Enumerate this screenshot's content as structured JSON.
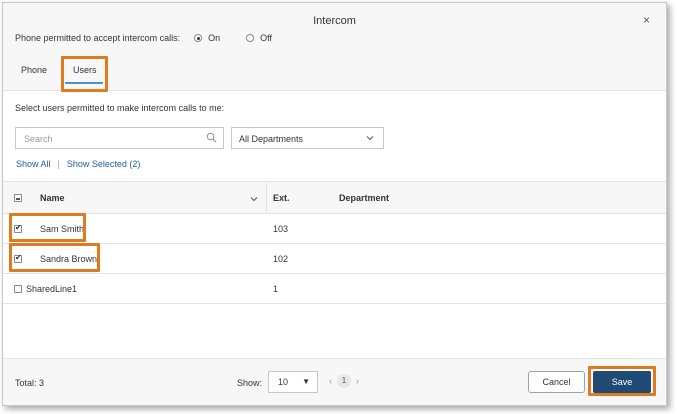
{
  "dialog": {
    "title": "Intercom",
    "close_glyph": "×"
  },
  "permission": {
    "label": "Phone permitted to accept intercom calls:",
    "options": [
      {
        "label": "On",
        "selected": true
      },
      {
        "label": "Off",
        "selected": false
      }
    ]
  },
  "tabs": [
    {
      "label": "Phone",
      "active": false
    },
    {
      "label": "Users",
      "active": true
    }
  ],
  "instructions": "Select users permitted to make intercom calls to me:",
  "search": {
    "placeholder": "Search",
    "icon": "search-icon"
  },
  "department_select": {
    "value": "All Departments",
    "icon": "chevron-down-icon"
  },
  "filters": {
    "show_all": "Show All",
    "separator": "|",
    "show_selected": "Show Selected (2)"
  },
  "table": {
    "columns": [
      "Name",
      "Ext.",
      "Department"
    ],
    "sort_glyph": "⌄",
    "rows": [
      {
        "name": "Sam Smith",
        "ext": "103",
        "department": "",
        "checked": true
      },
      {
        "name": "Sandra Brown",
        "ext": "102",
        "department": "",
        "checked": true
      },
      {
        "name": "SharedLine1",
        "ext": "1",
        "department": "",
        "checked": false
      }
    ]
  },
  "footer": {
    "total": "Total: 3",
    "show_label": "Show:",
    "page_size": "10",
    "page_size_arrow": "▼",
    "prev_glyph": "‹",
    "current_page": "1",
    "next_glyph": "›",
    "cancel_label": "Cancel",
    "save_label": "Save"
  },
  "colors": {
    "highlight": "#e07a1f",
    "save_button": "#1e4a73",
    "link": "#1f5fa3"
  }
}
